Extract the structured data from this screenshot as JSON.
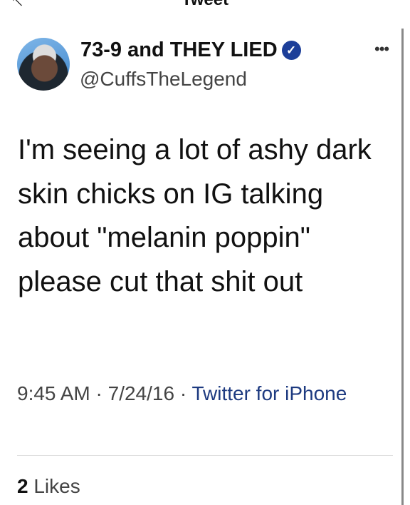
{
  "header": {
    "title": "Tweet"
  },
  "author": {
    "name": "73-9 and THEY LIED",
    "handle": "@CuffsTheLegend",
    "verified": true
  },
  "tweet": {
    "text": "I'm seeing a lot of ashy dark skin chicks on IG talking about \"melanin poppin\" please cut that shit out",
    "time": "9:45 AM",
    "date": "7/24/16",
    "source": "Twitter for iPhone",
    "separator": " · "
  },
  "stats": {
    "likes_count": "2",
    "likes_label": "Likes"
  },
  "icons": {
    "back": "arrow-left-icon",
    "verified": "verified-badge-icon",
    "more": "more-icon"
  },
  "colors": {
    "link": "#1d3a80",
    "badge": "#1d3f99"
  }
}
